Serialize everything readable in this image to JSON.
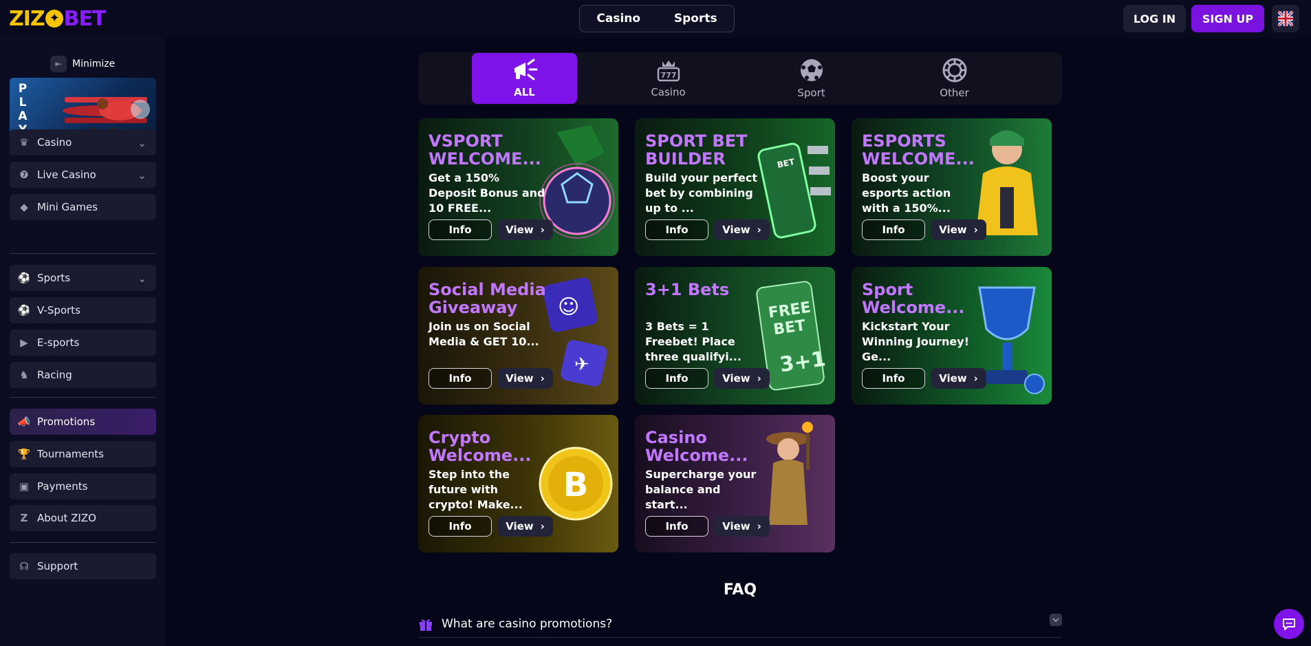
{
  "header": {
    "logo": {
      "part1": "ZIZ",
      "star": "✦",
      "part2": "BET"
    },
    "switcher": [
      "Casino",
      "Sports"
    ],
    "login_label": "LOG IN",
    "signup_label": "SIGN UP",
    "language_icon": "uk-flag-icon"
  },
  "sidebar": {
    "minimize_label": "Minimize",
    "play_banner_text": "PLAY",
    "items_group1": [
      {
        "label": "Casino",
        "icon": "casino-icon",
        "expandable": true
      },
      {
        "label": "Live Casino",
        "icon": "live-casino-icon",
        "expandable": true
      },
      {
        "label": "Mini Games",
        "icon": "diamond-icon",
        "expandable": false
      }
    ],
    "items_group2": [
      {
        "label": "Sports",
        "icon": "sports-ball-icon",
        "expandable": true
      },
      {
        "label": "V-Sports",
        "icon": "v-sports-icon",
        "expandable": false
      },
      {
        "label": "E-sports",
        "icon": "esports-icon",
        "expandable": false
      },
      {
        "label": "Racing",
        "icon": "horse-icon",
        "expandable": false
      }
    ],
    "items_group3": [
      {
        "label": "Promotions",
        "icon": "megaphone-icon",
        "active": true
      },
      {
        "label": "Tournaments",
        "icon": "trophy-icon"
      },
      {
        "label": "Payments",
        "icon": "wallet-icon"
      },
      {
        "label": "About ZIZO",
        "icon": "zizo-z-icon"
      }
    ],
    "support_label": "Support"
  },
  "tabs": [
    {
      "label": "ALL",
      "icon": "megaphone-icon",
      "active": true
    },
    {
      "label": "Casino",
      "icon": "slot-crown-icon"
    },
    {
      "label": "Sport",
      "icon": "soccer-ball-icon"
    },
    {
      "label": "Other",
      "icon": "chip-icon"
    }
  ],
  "promo_buttons": {
    "info": "Info",
    "view": "View"
  },
  "promos": [
    {
      "title": "VSPORT WELCOME...",
      "desc": "Get a 150% Deposit Bonus and 10 FREE...",
      "theme": "#14401f"
    },
    {
      "title": "SPORT BET BUILDER",
      "desc": "Build your perfect bet by combining up to ...",
      "theme": "#0f4a1e"
    },
    {
      "title": "ESPORTS WELCOME...",
      "desc": "Boost your esports action with a 150%...",
      "theme": "#11502a"
    },
    {
      "title": "Social Media Giveaway",
      "desc": "Join us on Social Media & GET 10...",
      "theme": "#3b2f10"
    },
    {
      "title": "3+1 Bets",
      "desc": "3 Bets = 1 Freebet! Place three qualifyi...",
      "theme": "#124a22"
    },
    {
      "title": "Sport Welcome...",
      "desc": "Kickstart Your Winning Journey! Ge...",
      "theme": "#0f5626"
    },
    {
      "title": "Crypto Welcome...",
      "desc": "Step into the future with crypto! Make...",
      "theme": "#3d3407"
    },
    {
      "title": "Casino Welcome...",
      "desc": "Supercharge your balance and start...",
      "theme": "#3a1f45"
    }
  ],
  "faq": {
    "title": "FAQ",
    "question": "What are casino promotions?"
  }
}
